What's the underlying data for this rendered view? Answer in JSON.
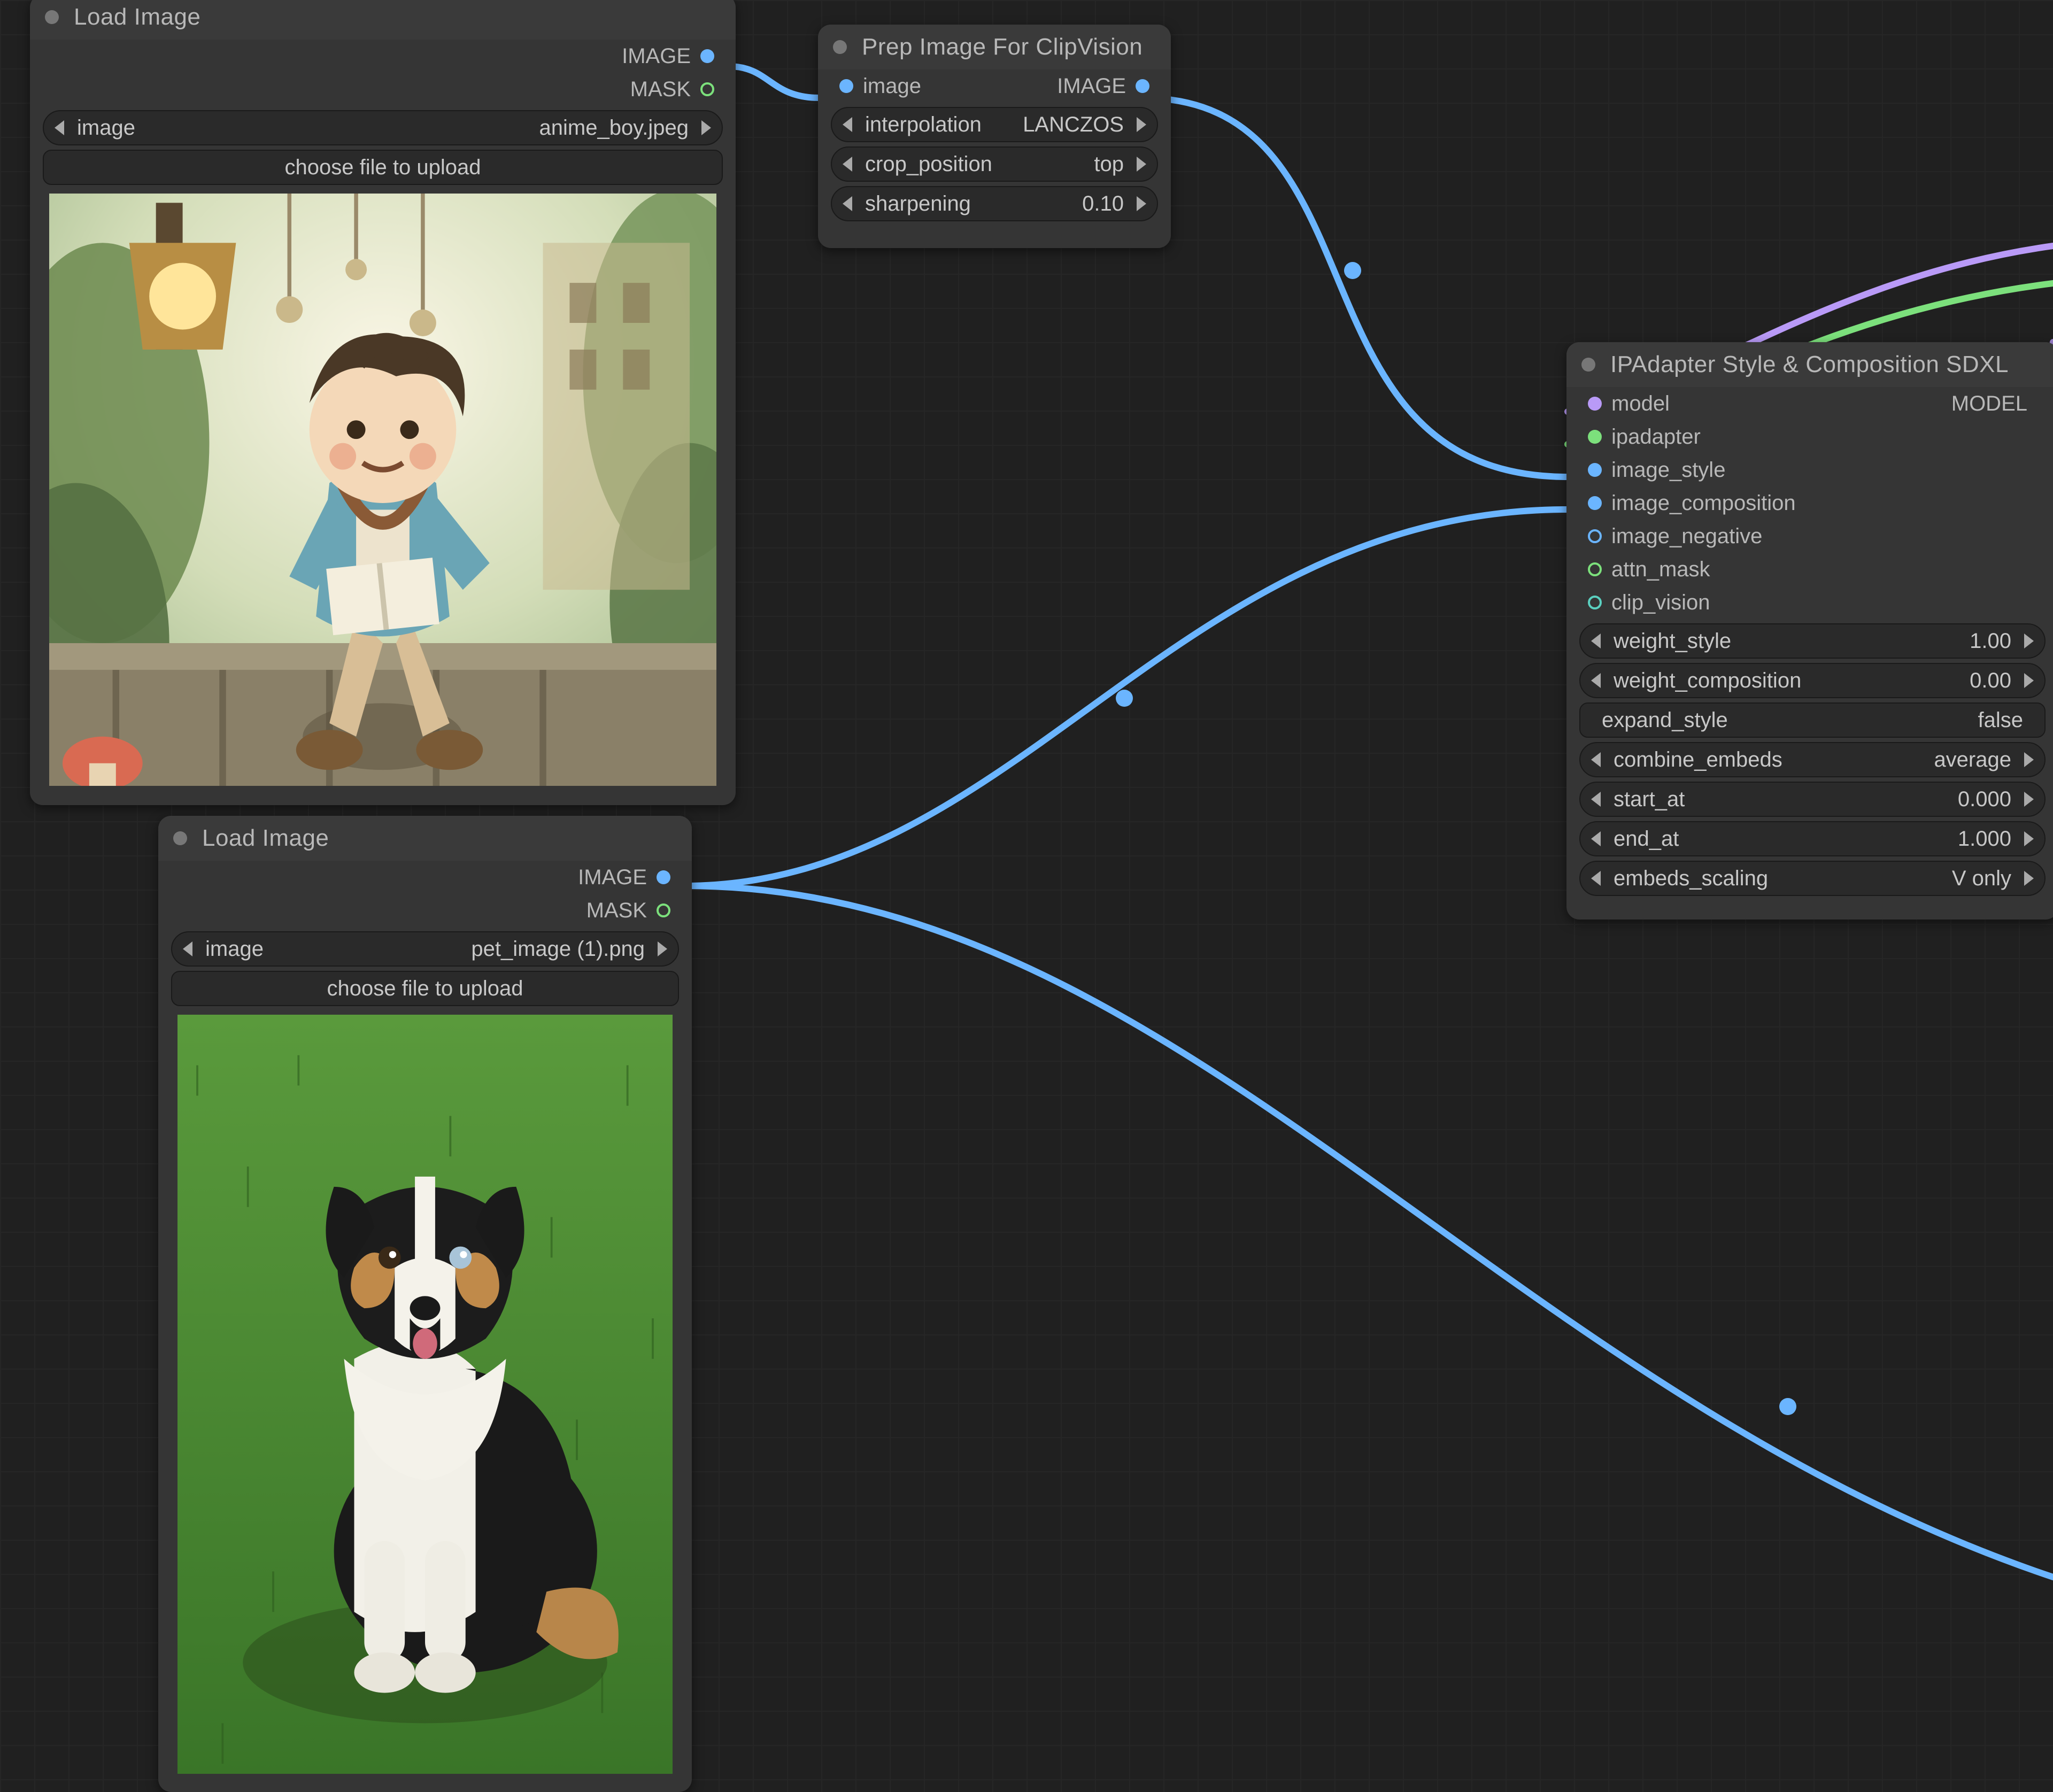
{
  "nodes": {
    "load1": {
      "title": "Load Image",
      "out_image": "IMAGE",
      "out_mask": "MASK",
      "widget_image_label": "image",
      "widget_image_value": "anime_boy.jpeg",
      "button_upload": "choose file to upload"
    },
    "load2": {
      "title": "Load Image",
      "out_image": "IMAGE",
      "out_mask": "MASK",
      "widget_image_label": "image",
      "widget_image_value": "pet_image (1).png",
      "button_upload": "choose file to upload"
    },
    "prep": {
      "title": "Prep Image For ClipVision",
      "in_image": "image",
      "out_image": "IMAGE",
      "interp_label": "interpolation",
      "interp_value": "LANCZOS",
      "crop_label": "crop_position",
      "crop_value": "top",
      "sharp_label": "sharpening",
      "sharp_value": "0.10"
    },
    "ipa": {
      "title": "IPAdapter Style & Composition SDXL",
      "in_model": "model",
      "in_ipadapter": "ipadapter",
      "in_image_style": "image_style",
      "in_image_composition": "image_composition",
      "in_image_negative": "image_negative",
      "in_attn_mask": "attn_mask",
      "in_clip_vision": "clip_vision",
      "out_model": "MODEL",
      "weight_style_label": "weight_style",
      "weight_style_value": "1.00",
      "weight_comp_label": "weight_composition",
      "weight_comp_value": "0.00",
      "expand_label": "expand_style",
      "expand_value": "false",
      "combine_label": "combine_embeds",
      "combine_value": "average",
      "start_label": "start_at",
      "start_value": "0.000",
      "end_label": "end_at",
      "end_value": "1.000",
      "embeds_label": "embeds_scaling",
      "embeds_value": "V only"
    }
  },
  "colors": {
    "link_blue": "#6bb5ff",
    "link_purple": "#b99af7",
    "link_green": "#7ce07c"
  }
}
